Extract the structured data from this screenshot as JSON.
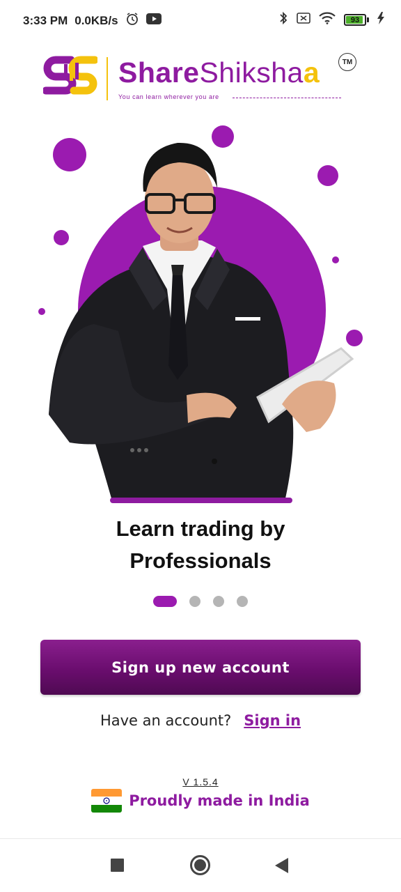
{
  "status_bar": {
    "time": "3:33 PM",
    "network_speed": "0.0KB/s",
    "battery_level": "93",
    "icons": [
      "alarm-icon",
      "youtube-icon",
      "bluetooth-icon",
      "sim-off-icon",
      "wifi-icon",
      "battery-icon",
      "charging-icon"
    ]
  },
  "logo": {
    "brand_share": "Share",
    "brand_shiksha": "Shiksha",
    "brand_a": "a",
    "tagline": "You can learn wherever you are",
    "trademark": "TM"
  },
  "colors": {
    "brand_purple": "#8e1ba0",
    "brand_yellow": "#f4c20d",
    "button_dark": "#6a0d6e",
    "inactive_dot": "#b5b5b5"
  },
  "onboarding": {
    "title_line1": "Learn trading by",
    "title_line2": "Professionals",
    "page_count": 4,
    "current_page": 1
  },
  "actions": {
    "signup_label": "Sign up new account",
    "have_account_text": "Have an account?",
    "signin_label": "Sign in"
  },
  "footer": {
    "version": "V 1.5.4",
    "made_in": "Proudly made in India"
  },
  "nav_bar": {
    "buttons": [
      "recents-button",
      "home-button",
      "back-button"
    ]
  }
}
